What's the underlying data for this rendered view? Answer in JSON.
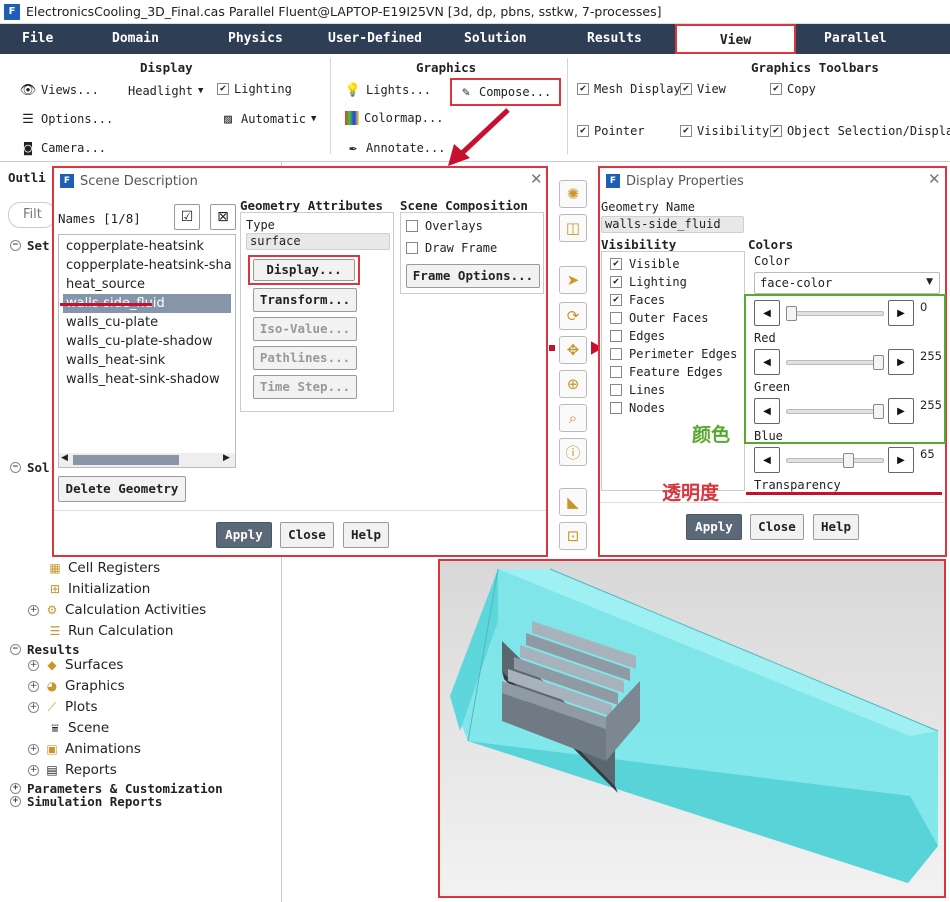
{
  "window": {
    "title": "ElectronicsCooling_3D_Final.cas Parallel Fluent@LAPTOP-E19I25VN  [3d, dp, pbns, sstkw, 7-processes]"
  },
  "menubar": [
    "File",
    "Domain",
    "Physics",
    "User-Defined",
    "Solution",
    "Results",
    "View",
    "Parallel"
  ],
  "ribbon": {
    "display": {
      "title": "Display",
      "views": "Views...",
      "headlight": "Headlight",
      "lighting": "Lighting",
      "options": "Options...",
      "automatic": "Automatic",
      "camera": "Camera..."
    },
    "graphics": {
      "title": "Graphics",
      "lights": "Lights...",
      "compose": "Compose...",
      "colormap": "Colormap...",
      "annotate": "Annotate..."
    },
    "toolbars": {
      "title": "Graphics Toolbars",
      "mesh_display": "Mesh Display",
      "view": "View",
      "copy": "Copy",
      "pointer": "Pointer",
      "visibility": "Visibility",
      "object_selection": "Object Selection/Display"
    }
  },
  "tree": {
    "outline_label": "Outli",
    "filter_label": "Filt",
    "setup_label": "Set",
    "solution_label": "Sol",
    "items_solution": [
      "Cell Registers",
      "Initialization",
      "Calculation Activities",
      "Run Calculation"
    ],
    "results_label": "Results",
    "items_results": [
      "Surfaces",
      "Graphics",
      "Plots",
      "Scene",
      "Animations",
      "Reports"
    ],
    "parameters_label": "Parameters & Customization",
    "sim_reports_label": "Simulation Reports"
  },
  "scene": {
    "title": "Scene Description",
    "names_label": "Names [1/8]",
    "names": [
      "copperplate-heatsink",
      "copperplate-heatsink-shadow",
      "heat_source",
      "walls-side_fluid",
      "walls_cu-plate",
      "walls_cu-plate-shadow",
      "walls_heat-sink",
      "walls_heat-sink-shadow"
    ],
    "selected_index": 3,
    "geometry_attributes": "Geometry Attributes",
    "type_label": "Type",
    "type_value": "surface",
    "display_btn": "Display...",
    "transform_btn": "Transform...",
    "isovalue_btn": "Iso-Value...",
    "pathlines_btn": "Pathlines...",
    "timestep_btn": "Time Step...",
    "scene_composition": "Scene Composition",
    "overlays": "Overlays",
    "draw_frame": "Draw Frame",
    "frame_options_btn": "Frame Options...",
    "delete_btn": "Delete Geometry",
    "apply": "Apply",
    "close": "Close",
    "help": "Help"
  },
  "props": {
    "title": "Display Properties",
    "geometry_name_label": "Geometry Name",
    "geometry_name": "walls-side_fluid",
    "visibility_label": "Visibility",
    "visibility_items": [
      {
        "label": "Visible",
        "checked": true
      },
      {
        "label": "Lighting",
        "checked": true
      },
      {
        "label": "Faces",
        "checked": true
      },
      {
        "label": "Outer Faces",
        "checked": false
      },
      {
        "label": "Edges",
        "checked": false
      },
      {
        "label": "Perimeter Edges",
        "checked": false
      },
      {
        "label": "Feature Edges",
        "checked": false
      },
      {
        "label": "Lines",
        "checked": false
      },
      {
        "label": "Nodes",
        "checked": false
      }
    ],
    "colors_label": "Colors",
    "color_label": "Color",
    "color_value": "face-color",
    "red_label": "Red",
    "red_value": "0",
    "red_frac": 0,
    "green_label": "Green",
    "green_value": "255",
    "green_frac": 1,
    "blue_label": "Blue",
    "blue_value": "255",
    "blue_frac": 1,
    "transparency_label": "Transparency",
    "transparency_value": "65",
    "transparency_frac": 0.65,
    "apply": "Apply",
    "close": "Close",
    "help": "Help"
  },
  "annotations": {
    "color_cn": "颜色",
    "transparency_cn": "透明度"
  },
  "colors": {
    "accent_red": "#d9363e",
    "accent_green": "#5aa832",
    "fluid": "#7de8ec",
    "menubar": "#2d3e55"
  }
}
